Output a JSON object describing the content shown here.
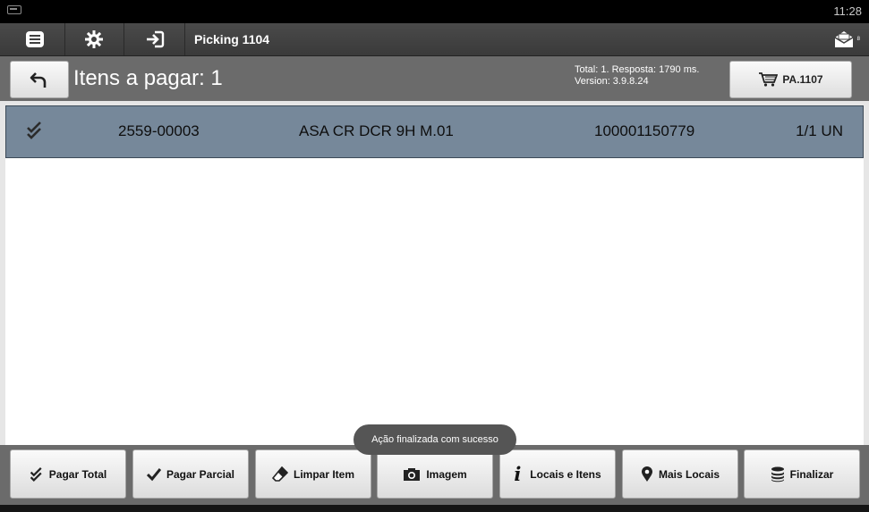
{
  "statusbar": {
    "time": "11:28",
    "keyboard_icon": "keyboard-icon"
  },
  "actionbar": {
    "menu_icon": "menu-icon",
    "settings_icon": "gear-icon",
    "login_icon": "login-icon",
    "title": "Picking 1104",
    "mail_icon": "mail-icon",
    "mail_badge": "8"
  },
  "header": {
    "back_icon": "undo-icon",
    "title": "Itens a pagar: 1",
    "stats_line1": "Total: 1. Resposta: 1790 ms.",
    "stats_line2": "Version: 3.9.8.24",
    "cart_button": "PA.1107",
    "cart_icon": "cart-icon"
  },
  "list": {
    "rows": [
      {
        "code": "2559-00003",
        "description": "ASA CR DCR 9H M.01",
        "ean": "100001150779",
        "quantity": "1/1 UN",
        "status_icon": "double-check-icon"
      }
    ]
  },
  "toast": "Ação finalizada com sucesso",
  "bottom": {
    "buttons": [
      {
        "label": "Pagar Total",
        "icon": "double-check-icon"
      },
      {
        "label": "Pagar Parcial",
        "icon": "check-icon"
      },
      {
        "label": "Limpar Item",
        "icon": "eraser-icon"
      },
      {
        "label": "Imagem",
        "icon": "camera-icon"
      },
      {
        "label": "Locais e Itens",
        "icon": "info-icon"
      },
      {
        "label": "Mais Locais",
        "icon": "map-pin-icon"
      },
      {
        "label": "Finalizar",
        "icon": "database-icon"
      }
    ]
  },
  "colors": {
    "selected_row": "#76889a",
    "toolbar": "#6b6b6b",
    "action_bar": "#3f3f3f"
  }
}
